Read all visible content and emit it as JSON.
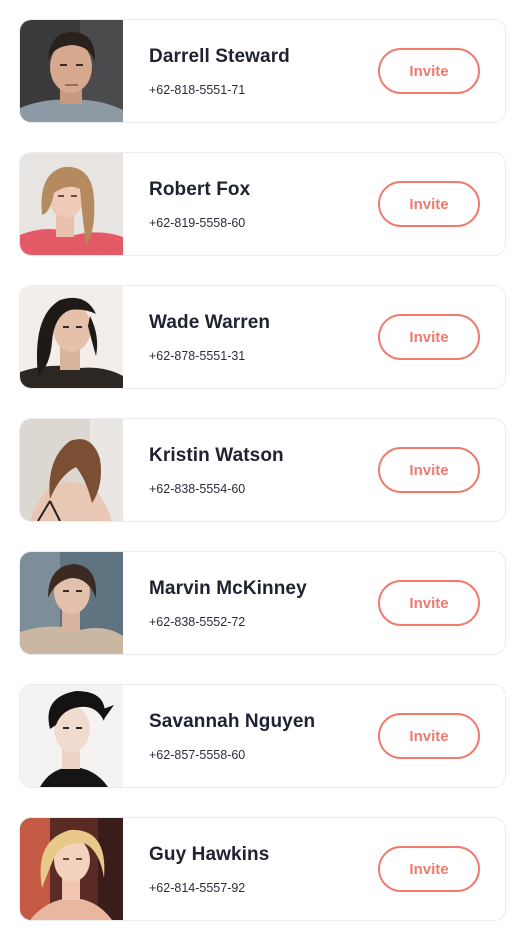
{
  "colors": {
    "accent": "#ef7a6d",
    "name_text": "#1f2230",
    "phone_text": "#2b2e3a",
    "card_border": "#ececef"
  },
  "contacts": [
    {
      "name": "Darrell Steward",
      "phone": "+62-818-5551-71",
      "invite_label": "Invite",
      "avatar": "portrait-dark-hair-man"
    },
    {
      "name": "Robert Fox",
      "phone": "+62-819-5558-60",
      "invite_label": "Invite",
      "avatar": "portrait-blonde-woman"
    },
    {
      "name": "Wade Warren",
      "phone": "+62-878-5551-31",
      "invite_label": "Invite",
      "avatar": "portrait-wet-hair-woman"
    },
    {
      "name": "Kristin Watson",
      "phone": "+62-838-5554-60",
      "invite_label": "Invite",
      "avatar": "portrait-woman-back"
    },
    {
      "name": "Marvin McKinney",
      "phone": "+62-838-5552-72",
      "invite_label": "Invite",
      "avatar": "portrait-woman-reclining"
    },
    {
      "name": "Savannah Nguyen",
      "phone": "+62-857-5558-60",
      "invite_label": "Invite",
      "avatar": "portrait-black-hair-man"
    },
    {
      "name": "Guy Hawkins",
      "phone": "+62-814-5557-92",
      "invite_label": "Invite",
      "avatar": "portrait-blonde-girl"
    }
  ]
}
